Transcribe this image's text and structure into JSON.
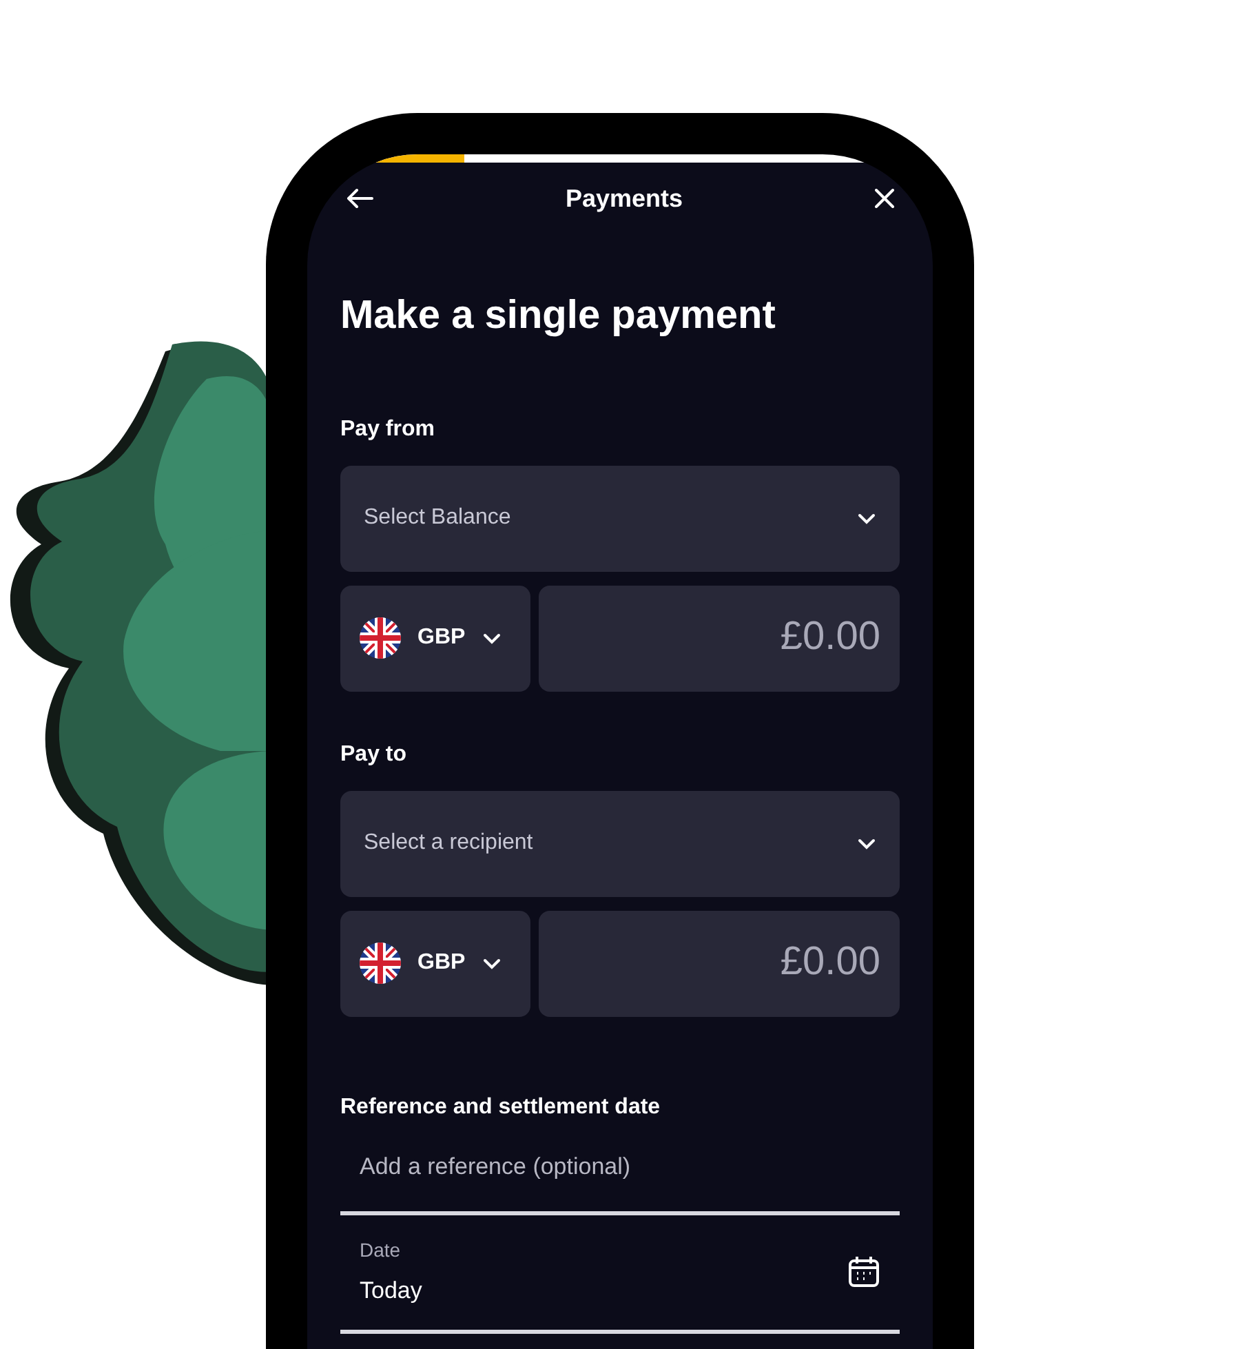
{
  "header": {
    "title": "Payments"
  },
  "progress": {
    "level": 0.25
  },
  "heading": "Make a single payment",
  "sections": [
    {
      "label": "Pay from",
      "select": {
        "placeholder": "Select Balance"
      },
      "currency": "GBP",
      "amount": "£0.00"
    },
    {
      "label": "Pay to",
      "select": {
        "placeholder": "Select a recipient"
      },
      "currency": "GBP",
      "amount": "£0.00"
    }
  ],
  "reference": {
    "label": "Reference and settlement date",
    "placeholder": "Add a reference (optional)",
    "date_label": "Date",
    "date_value": "Today"
  }
}
